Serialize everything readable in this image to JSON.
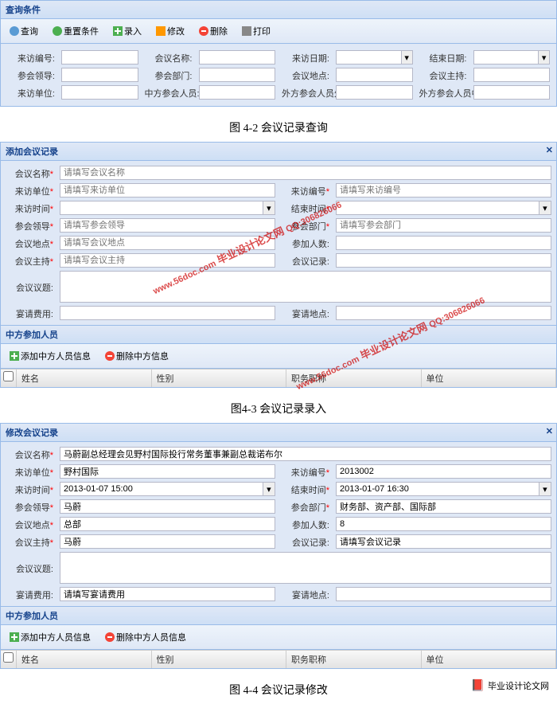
{
  "panel1": {
    "title": "查询条件",
    "toolbar": {
      "search": "查询",
      "reset": "重置条件",
      "add": "录入",
      "edit": "修改",
      "delete": "删除",
      "print": "打印"
    },
    "labels": {
      "r1c1": "来访编号:",
      "r1c2": "会议名称:",
      "r1c3": "来访日期:",
      "r1c4": "结束日期:",
      "r2c1": "参会领导:",
      "r2c2": "参会部门:",
      "r2c3": "会议地点:",
      "r2c4": "会议主持:",
      "r3c1": "来访单位:",
      "r3c2": "中方参会人员:",
      "r3c3": "外方参会人员外文名:",
      "r3c4": "外方参会人员中文名:"
    }
  },
  "caption1": "图 4-2  会议记录查询",
  "panel2": {
    "title": "添加会议记录",
    "labels": {
      "name": "会议名称",
      "unit": "来访单位",
      "code": "来访编号",
      "codeHint": "请填写来访编号",
      "startTime": "来访时间",
      "endTime": "结束时间",
      "leader": "参会领导",
      "leaderHint": "请填写参会领导",
      "dept": "参会部门",
      "deptHint": "请填写参会部门",
      "loc": "会议地点",
      "locHint": "请填写会议地点",
      "people": "参加人数:",
      "host": "会议主持",
      "hostHint": "请填写会议主持",
      "record": "会议记录:",
      "topic": "会议议题:",
      "nameHint": "请填写会议名称",
      "unitHint": "请填写来访单位",
      "fee": "宴请费用:",
      "feeLoc": "宴请地点:"
    },
    "sub": "中方参加人员",
    "subtoolbar": {
      "add": "添加中方人员信息",
      "del": "删除中方信息"
    },
    "cols": {
      "name": "姓名",
      "gender": "性别",
      "position": "职务职称",
      "unit": "单位"
    }
  },
  "caption2": "图4-3  会议记录录入",
  "panel3": {
    "title": "修改会议记录",
    "vals": {
      "name": "马蔚副总经理会见野村国际投行常务董事兼副总裁诺布尔",
      "unit": "野村国际",
      "code": "2013002",
      "start": "2013-01-07 15:00",
      "end": "2013-01-07 16:30",
      "leader": "马蔚",
      "dept": "财务部、资产部、国际部",
      "loc": "总部",
      "people": "8",
      "host": "马蔚",
      "record": "请填写会议记录",
      "fee": "请填写宴请费用"
    },
    "sub": "中方参加人员",
    "subtoolbar": {
      "add": "添加中方人员信息",
      "del": "删除中方人员信息"
    },
    "cols": {
      "name": "姓名",
      "gender": "性别",
      "position": "职务职称",
      "unit": "单位"
    }
  },
  "caption3": "图 4-4  会议记录修改",
  "footer": "毕业设计论文网",
  "watermark": {
    "url": "www.56doc.com",
    "qq": "QQ:306826066"
  }
}
